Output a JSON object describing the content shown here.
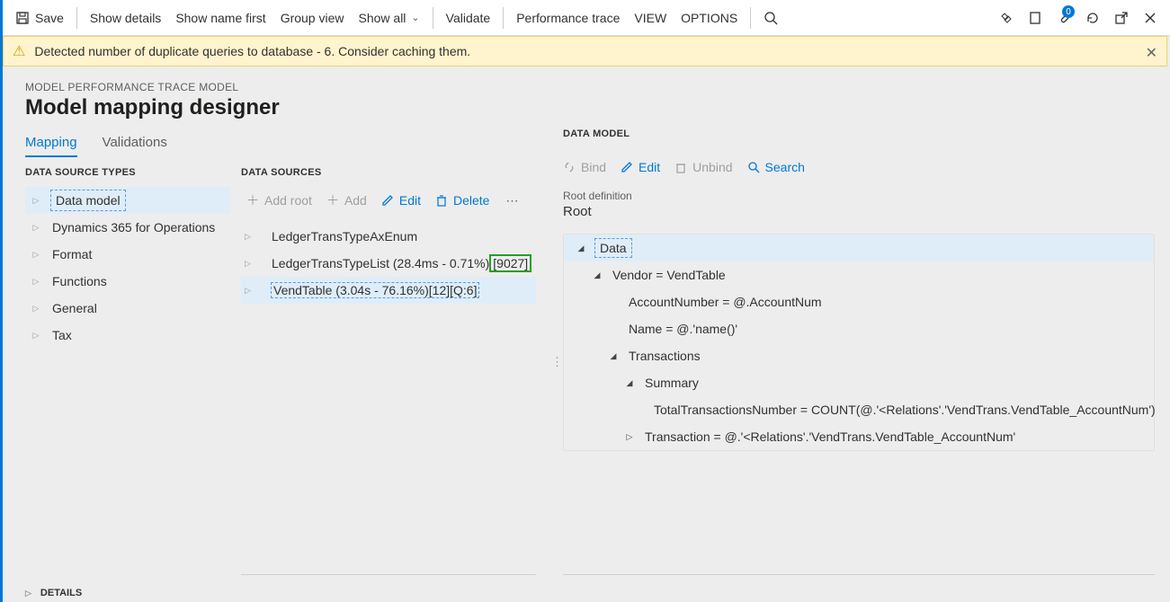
{
  "toolbar": {
    "save_label": "Save",
    "show_details_label": "Show details",
    "show_name_first_label": "Show name first",
    "group_view_label": "Group view",
    "show_all_label": "Show all",
    "validate_label": "Validate",
    "perf_trace_label": "Performance trace",
    "view_label": "VIEW",
    "options_label": "OPTIONS",
    "attachments_badge": "0"
  },
  "warning": {
    "text": "Detected number of duplicate queries to database - 6. Consider caching them."
  },
  "breadcrumb": "MODEL PERFORMANCE TRACE MODEL",
  "page_title": "Model mapping designer",
  "tabs": {
    "mapping": "Mapping",
    "validations": "Validations"
  },
  "data_source_types": {
    "header": "DATA SOURCE TYPES",
    "items": [
      "Data model",
      "Dynamics 365 for Operations",
      "Format",
      "Functions",
      "General",
      "Tax"
    ]
  },
  "data_sources": {
    "header": "DATA SOURCES",
    "btn_add_root": "Add root",
    "btn_add": "Add",
    "btn_edit": "Edit",
    "btn_delete": "Delete",
    "items": {
      "r0": "LedgerTransTypeAxEnum",
      "r1_main": "LedgerTransTypeList (28.4ms - 0.71%)",
      "r1_tag": "[9027]",
      "r2": "VendTable (3.04s - 76.16%)[12][Q:6]"
    }
  },
  "data_model": {
    "header": "DATA MODEL",
    "btn_bind": "Bind",
    "btn_edit": "Edit",
    "btn_unbind": "Unbind",
    "btn_search": "Search",
    "root_label": "Root definition",
    "root_value": "Root",
    "tree": {
      "n0": "Data",
      "n1": "Vendor = VendTable",
      "n2": "AccountNumber = @.AccountNum",
      "n3": "Name = @.'name()'",
      "n4": "Transactions",
      "n5": "Summary",
      "n6": "TotalTransactionsNumber = COUNT(@.'<Relations'.'VendTrans.VendTable_AccountNum')",
      "n7": "Transaction = @.'<Relations'.'VendTrans.VendTable_AccountNum'"
    }
  },
  "details_header": "DETAILS"
}
